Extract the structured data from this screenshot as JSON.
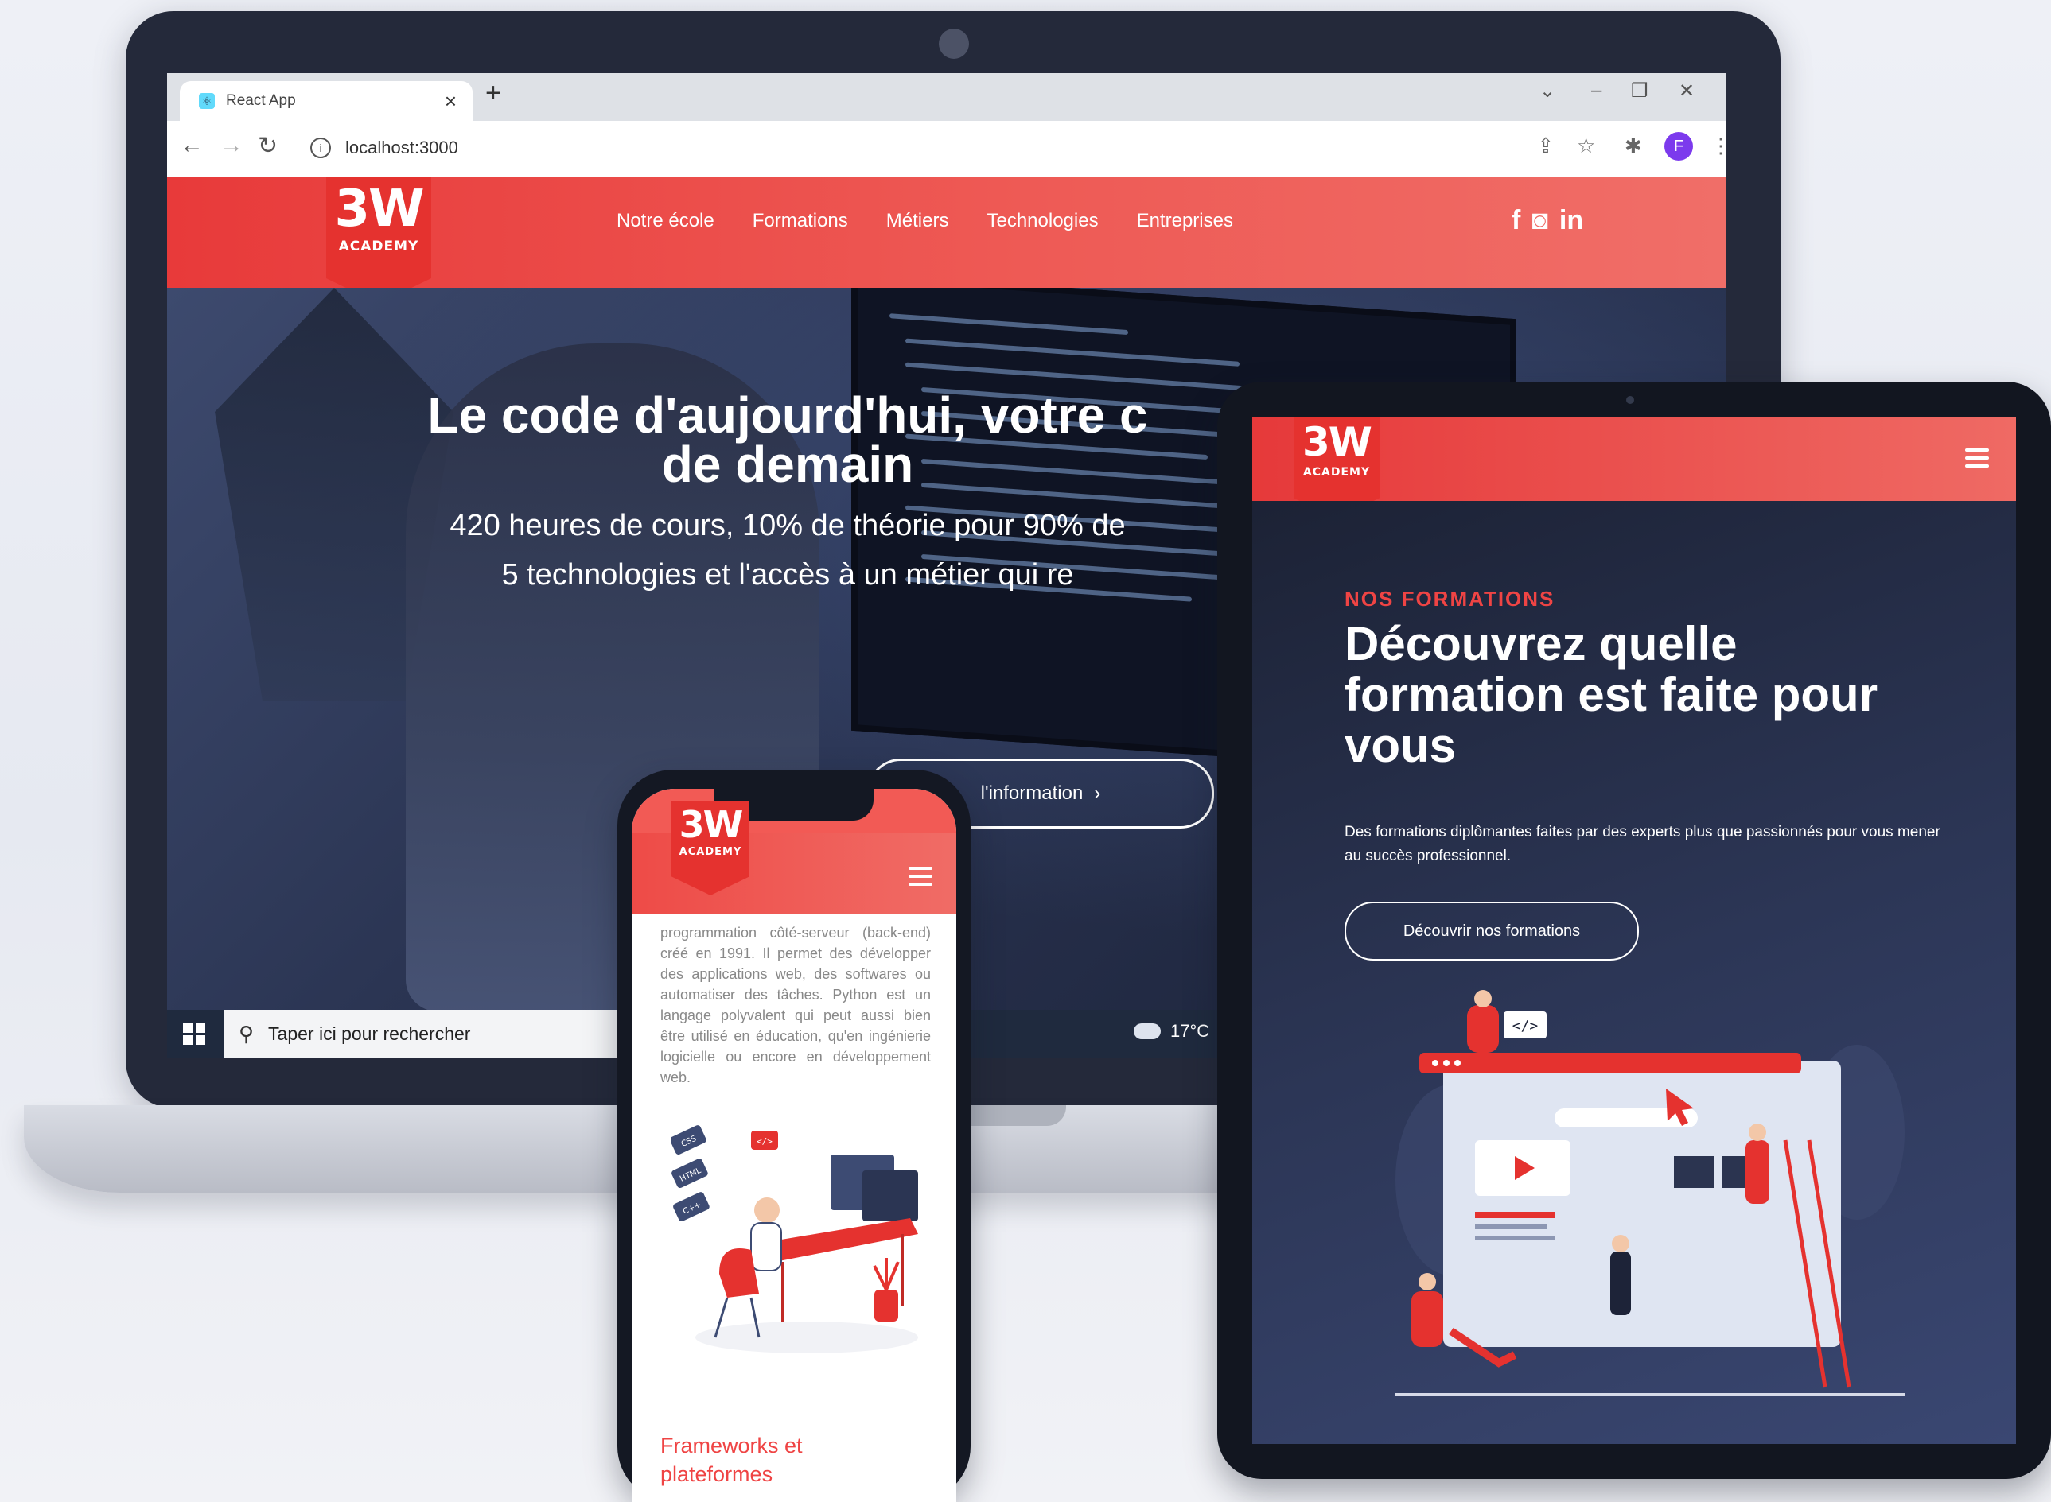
{
  "browser": {
    "tab_title": "React App",
    "tab_close": "×",
    "new_tab": "+",
    "url": "localhost:3000",
    "profile_initial": "F",
    "window_controls": {
      "dropdown": "⌄",
      "minimize": "–",
      "restore": "❐",
      "close": "✕"
    },
    "nav_icons": {
      "back": "←",
      "forward": "→",
      "reload": "↻"
    },
    "toolbar_icons": {
      "share": "⇪",
      "star": "☆",
      "extensions": "✱",
      "menu": "⋮"
    }
  },
  "brand": {
    "logo_main": "3W",
    "logo_sub": "ACADEMY",
    "primary_color": "#e83a3a",
    "dark_color": "#2a3350"
  },
  "site_nav": [
    "Notre école",
    "Formations",
    "Métiers",
    "Technologies",
    "Entreprises"
  ],
  "socials": [
    "f",
    "◙",
    "in"
  ],
  "hero": {
    "title_line1": "Le code d'aujourd'hui, votre c",
    "title_line2": "de demain",
    "sub_line1": "420 heures de cours, 10% de théorie pour 90% de",
    "sub_line2": "5 technologies et l'accès à un métier qui re",
    "cta": "l'information",
    "cta_arrow": "›"
  },
  "taskbar": {
    "search_placeholder": "Taper ici pour rechercher",
    "search_icon": "⚲",
    "temperature": "17°C"
  },
  "tablet": {
    "kicker": "NOS FORMATIONS",
    "title": "Découvrez quelle formation est faite pour vous",
    "description": "Des formations diplômantes faites par des experts plus que passionnés pour vous mener au succès professionnel.",
    "button": "Découvrir nos formations",
    "illus_code_tag": "</>"
  },
  "phone": {
    "paragraph": "programmation côté-serveur (back-end) créé en 1991. Il permet des développer des applications web, des softwares ou automatiser des tâches. Python est un langage polyvalent qui peut aussi bien être utilisé en éducation, qu'en ingénierie logicielle ou encore en développement web.",
    "tags": [
      "CSS",
      "HTML",
      "C++"
    ],
    "illus_code_tag": "</>",
    "heading": "Frameworks et plateformes"
  }
}
